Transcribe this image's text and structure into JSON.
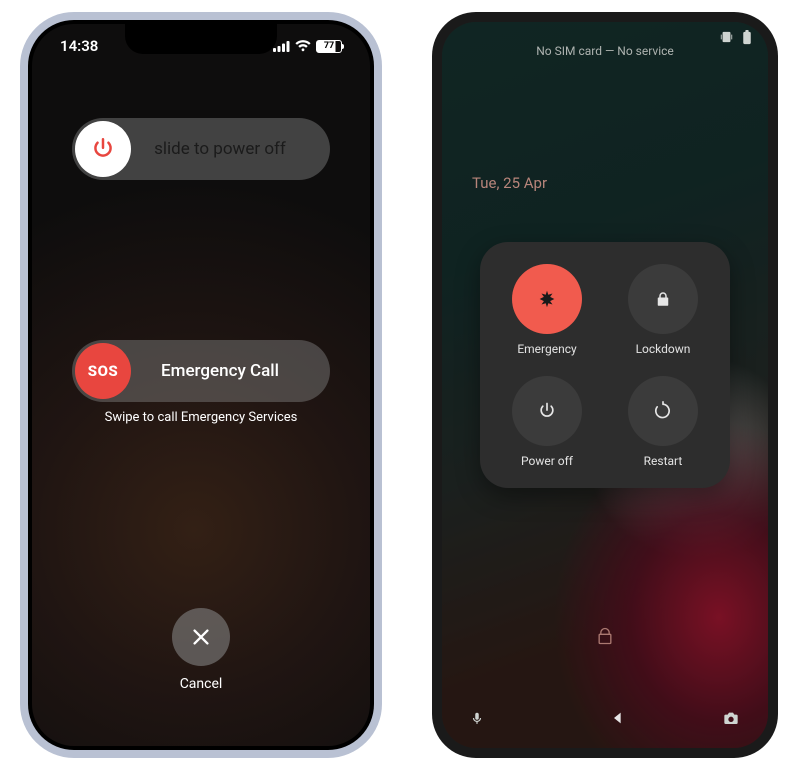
{
  "ios": {
    "time": "14:38",
    "battery": "77",
    "power_slider_label": "slide to power off",
    "sos_knob_text": "SOS",
    "sos_slider_label": "Emergency Call",
    "sos_hint": "Swipe to call Emergency Services",
    "cancel_label": "Cancel"
  },
  "android": {
    "status_center": "No SIM card — No service",
    "date": "Tue, 25 Apr",
    "menu": {
      "emergency": "Emergency",
      "lockdown": "Lockdown",
      "power_off": "Power off",
      "restart": "Restart"
    }
  }
}
